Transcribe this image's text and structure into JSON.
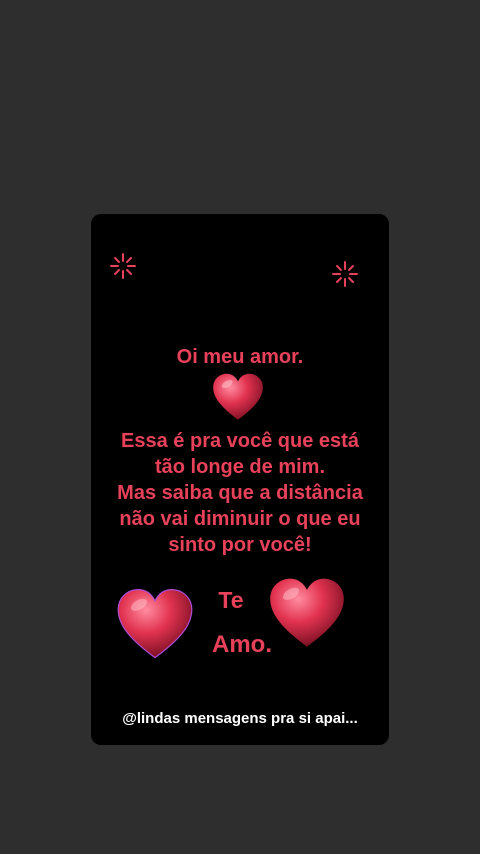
{
  "story": {
    "greeting": "Oi meu amor.",
    "message_lines": [
      "Essa é pra você que está",
      "tão longe de mim.",
      "Mas saiba que a distância",
      "não vai diminuir o que eu",
      "sinto por você!"
    ],
    "te": "Te",
    "amo": "Amo.",
    "caption": "@lindas mensagens pra si apai..."
  },
  "colors": {
    "background": "#2f2e2f",
    "card": "#000000",
    "text_red": "#e8415a",
    "heart": "#d9364f"
  },
  "icons": [
    "sparkle-icon",
    "heart-icon"
  ]
}
